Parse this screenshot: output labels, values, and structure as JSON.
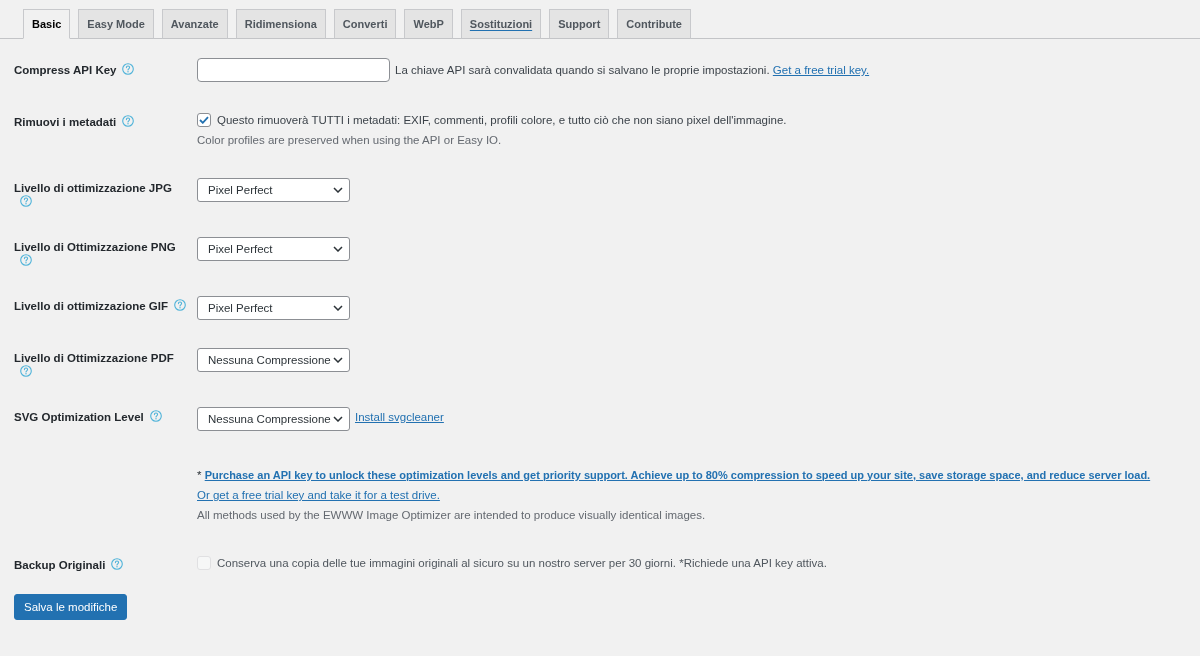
{
  "tabs": [
    {
      "label": "Basic",
      "selected": true,
      "hovered": false
    },
    {
      "label": "Easy Mode",
      "selected": false,
      "hovered": false
    },
    {
      "label": "Avanzate",
      "selected": false,
      "hovered": false
    },
    {
      "label": "Ridimensiona",
      "selected": false,
      "hovered": false
    },
    {
      "label": "Converti",
      "selected": false,
      "hovered": false
    },
    {
      "label": "WebP",
      "selected": false,
      "hovered": false
    },
    {
      "label": "Sostituzioni",
      "selected": false,
      "hovered": true
    },
    {
      "label": "Support",
      "selected": false,
      "hovered": false
    },
    {
      "label": "Contribute",
      "selected": false,
      "hovered": false
    }
  ],
  "settings": [
    {
      "kind": "text_input",
      "label": "Compress API Key",
      "description": "La chiave API sarà convalidata quando si salvano le proprie impostazioni.",
      "link": "Get a free trial key."
    },
    {
      "kind": "checkbox",
      "label": "Rimuovi i metadati",
      "checked": true,
      "disabled": false,
      "text": "Questo rimuoverà TUTTI i metadati: EXIF, commenti, profili colore, e tutto ciò che non siano pixel dell'immagine.",
      "note": "Color profiles are preserved when using the API or Easy IO."
    },
    {
      "kind": "select",
      "label": "Livello di ottimizzazione JPG",
      "value": "Pixel Perfect"
    },
    {
      "kind": "select",
      "label": "Livello di Ottimizzazione PNG",
      "value": "Pixel Perfect"
    },
    {
      "kind": "select",
      "label": "Livello di ottimizzazione GIF",
      "value": "Pixel Perfect"
    },
    {
      "kind": "select",
      "label": "Livello di Ottimizzazione PDF",
      "value": "Nessuna Compressione"
    },
    {
      "kind": "select",
      "label": "SVG Optimization Level",
      "value": "Nessuna Compressione",
      "link": "Install svgcleaner"
    },
    {
      "kind": "notice",
      "prefix": "*",
      "link": "Purchase an API key to unlock these optimization levels and get priority support. Achieve up to 80% compression to speed up your site, save storage space, and reduce server load.",
      "trial_link": "Or get a free trial key and take it for a test drive.",
      "note": "All methods used by the EWWW Image Optimizer are intended to produce visually identical images."
    },
    {
      "kind": "checkbox",
      "label": "Backup Originali",
      "checked": false,
      "disabled": true,
      "text": "Conserva una copia delle tue immagini originali al sicuro su un nostro server per 30 giorni. *Richiede una API key attiva."
    }
  ],
  "save_button": {
    "label": "Salva le modifiche"
  }
}
